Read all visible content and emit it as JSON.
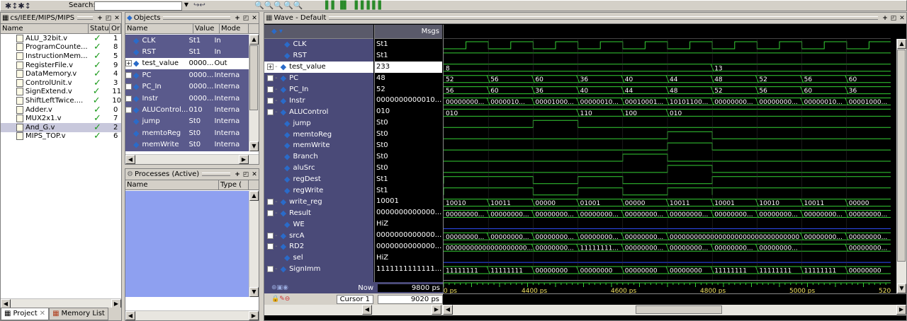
{
  "toolbar": {
    "search_label": "Search:",
    "search_value": ""
  },
  "files_panel": {
    "title": "cs/IEEE/MIPS/MIPS",
    "columns": [
      "Name",
      "Status",
      "Or"
    ],
    "items": [
      {
        "name": "ALU_32bit.v",
        "status": "✓",
        "order": "1"
      },
      {
        "name": "ProgramCounte...",
        "status": "✓",
        "order": "8"
      },
      {
        "name": "InstructionMem...",
        "status": "✓",
        "order": "5"
      },
      {
        "name": "RegisterFile.v",
        "status": "✓",
        "order": "9"
      },
      {
        "name": "DataMemory.v",
        "status": "✓",
        "order": "4"
      },
      {
        "name": "ControlUnit.v",
        "status": "✓",
        "order": "3"
      },
      {
        "name": "SignExtend.v",
        "status": "✓",
        "order": "11"
      },
      {
        "name": "ShiftLeftTwice....",
        "status": "✓",
        "order": "10"
      },
      {
        "name": "Adder.v",
        "status": "✓",
        "order": "0"
      },
      {
        "name": "MUX2x1.v",
        "status": "✓",
        "order": "7"
      },
      {
        "name": "And_G.v",
        "status": "✓",
        "order": "2"
      },
      {
        "name": "MIPS_TOP.v",
        "status": "✓",
        "order": "6"
      }
    ],
    "tabs": [
      "Project",
      "Memory List"
    ]
  },
  "objects_panel": {
    "title": "Objects",
    "columns": [
      "Name",
      "Value",
      "Mode"
    ],
    "items": [
      {
        "name": "CLK",
        "value": "St1",
        "mode": "In",
        "expand": false
      },
      {
        "name": "RST",
        "value": "St1",
        "mode": "In",
        "expand": false
      },
      {
        "name": "test_value",
        "value": "0000...",
        "mode": "Out",
        "expand": true
      },
      {
        "name": "PC",
        "value": "0000...",
        "mode": "Interna",
        "expand": true
      },
      {
        "name": "PC_In",
        "value": "0000...",
        "mode": "Interna",
        "expand": true
      },
      {
        "name": "Instr",
        "value": "0000...",
        "mode": "Interna",
        "expand": true
      },
      {
        "name": "ALUControl...",
        "value": "010",
        "mode": "Interna",
        "expand": true
      },
      {
        "name": "jump",
        "value": "St0",
        "mode": "Interna",
        "expand": false
      },
      {
        "name": "memtoReg",
        "value": "St0",
        "mode": "Interna",
        "expand": false
      },
      {
        "name": "memWrite",
        "value": "St0",
        "mode": "Interna",
        "expand": false
      }
    ]
  },
  "processes_panel": {
    "title": "Processes (Active)",
    "columns": [
      "Name",
      "Type ("
    ]
  },
  "wave_panel": {
    "title": "Wave - Default",
    "msgs_label": "Msgs",
    "signals": [
      {
        "name": "CLK",
        "value": "St1",
        "expand": false
      },
      {
        "name": "RST",
        "value": "St1",
        "expand": false
      },
      {
        "name": "test_value",
        "value": "233",
        "expand": true
      },
      {
        "name": "PC",
        "value": "48",
        "expand": true
      },
      {
        "name": "PC_In",
        "value": "52",
        "expand": true
      },
      {
        "name": "Instr",
        "value": "0000000000010...",
        "expand": true
      },
      {
        "name": "ALUControl",
        "value": "010",
        "expand": true
      },
      {
        "name": "jump",
        "value": "St0",
        "expand": false
      },
      {
        "name": "memtoReg",
        "value": "St0",
        "expand": false
      },
      {
        "name": "memWrite",
        "value": "St0",
        "expand": false
      },
      {
        "name": "Branch",
        "value": "St0",
        "expand": false
      },
      {
        "name": "aluSrc",
        "value": "St0",
        "expand": false
      },
      {
        "name": "regDest",
        "value": "St1",
        "expand": false
      },
      {
        "name": "regWrite",
        "value": "St1",
        "expand": false
      },
      {
        "name": "write_reg",
        "value": "10001",
        "expand": true
      },
      {
        "name": "Result",
        "value": "0000000000000...",
        "expand": true
      },
      {
        "name": "WE",
        "value": "HiZ",
        "expand": false
      },
      {
        "name": "srcA",
        "value": "0000000000000...",
        "expand": true
      },
      {
        "name": "RD2",
        "value": "0000000000000...",
        "expand": true
      },
      {
        "name": "sel",
        "value": "HiZ",
        "expand": false
      },
      {
        "name": "SignImm",
        "value": "1111111111111...",
        "expand": true
      }
    ],
    "now_label": "Now",
    "now_value": "9800 ps",
    "cursor_label": "Cursor 1",
    "cursor_value": "9020 ps",
    "time_ticks": [
      "0 ps",
      "4400 ps",
      "4600 ps",
      "4800 ps",
      "5000 ps",
      "520"
    ],
    "bus_labels": {
      "test_value": [
        "8",
        "13"
      ],
      "PC": [
        "52",
        "56",
        "60",
        "36",
        "40",
        "44",
        "48",
        "52",
        "56",
        "60"
      ],
      "PC_In": [
        "56",
        "60",
        "36",
        "40",
        "44",
        "48",
        "52",
        "56",
        "60",
        "36"
      ],
      "Instr": [
        "00000000...",
        "0000010...",
        "00001000...",
        "00000010...",
        "00010001...",
        "10101100...",
        "00000000...",
        "00000000...",
        "00000010...",
        "00001000..."
      ],
      "ALUControl": [
        "010",
        "110",
        "100",
        "010"
      ],
      "write_reg": [
        "10010",
        "10011",
        "00000",
        "01001",
        "00000",
        "10011",
        "10001",
        "10010",
        "10011",
        "00000"
      ],
      "Result": [
        "00000000...",
        "00000000...",
        "00000000...",
        "00000000...",
        "00000000...",
        "00000000...",
        "00000000...",
        "00000000...",
        "00000000...",
        "00000000..."
      ],
      "srcA": [
        "00000000...",
        "00000000...",
        "00000000...",
        "00000000...",
        "00000000...",
        "00000000000000000000000000000000",
        "00000000...",
        "00000000..."
      ],
      "RD2": [
        "00000000000000000000...",
        "00000000...",
        "11111111...",
        "00000000...",
        "00000000...",
        "00000000...",
        "00000000...",
        "00000000..."
      ],
      "SignImm": [
        "11111111",
        "11111111",
        "00000000",
        "00000000",
        "00000000",
        "00000000",
        "11111111",
        "11111111",
        "11111111",
        "00000000"
      ]
    }
  },
  "colors": {
    "wave_bg": "#000000",
    "wave_green": "#35d035",
    "wave_blue": "#3050ff",
    "signal_panel_bg": "#4a4a78",
    "value_panel_bg": "#000000",
    "objects_bg": "#5a5a8c",
    "processes_bg": "#8ea0f0"
  }
}
